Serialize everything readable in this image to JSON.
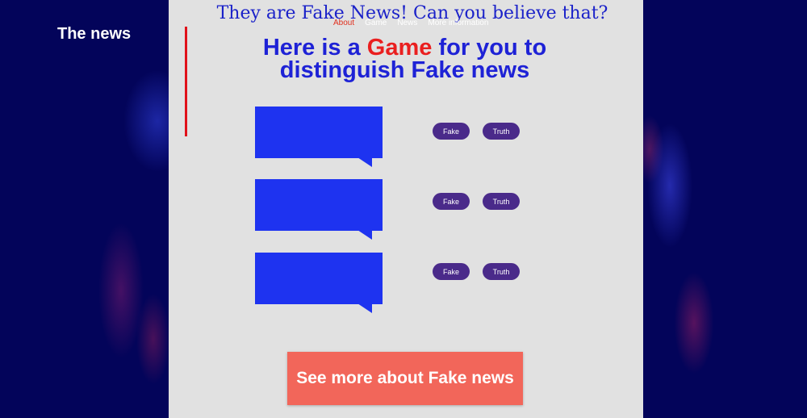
{
  "site": {
    "title": "The news"
  },
  "headline": "They are Fake News! Can you believe that?",
  "nav": {
    "items": [
      "About",
      "Game",
      "News",
      "More information"
    ]
  },
  "game": {
    "heading_before": "Here is a ",
    "heading_highlight": "Game",
    "heading_after": " for you to distinguish Fake news",
    "rows": [
      {
        "fake_label": "Fake",
        "truth_label": "Truth"
      },
      {
        "fake_label": "Fake",
        "truth_label": "Truth"
      },
      {
        "fake_label": "Fake",
        "truth_label": "Truth"
      }
    ]
  },
  "cta": {
    "label": "See more about Fake news"
  },
  "colors": {
    "background": "#03045a",
    "panel": "#e1e1e1",
    "heading_blue": "#1e22d6",
    "highlight_red": "#ea1f1f",
    "bubble_blue": "#1e33f0",
    "pill_purple": "#4a2a8a",
    "cta_salmon": "#f2665a"
  }
}
